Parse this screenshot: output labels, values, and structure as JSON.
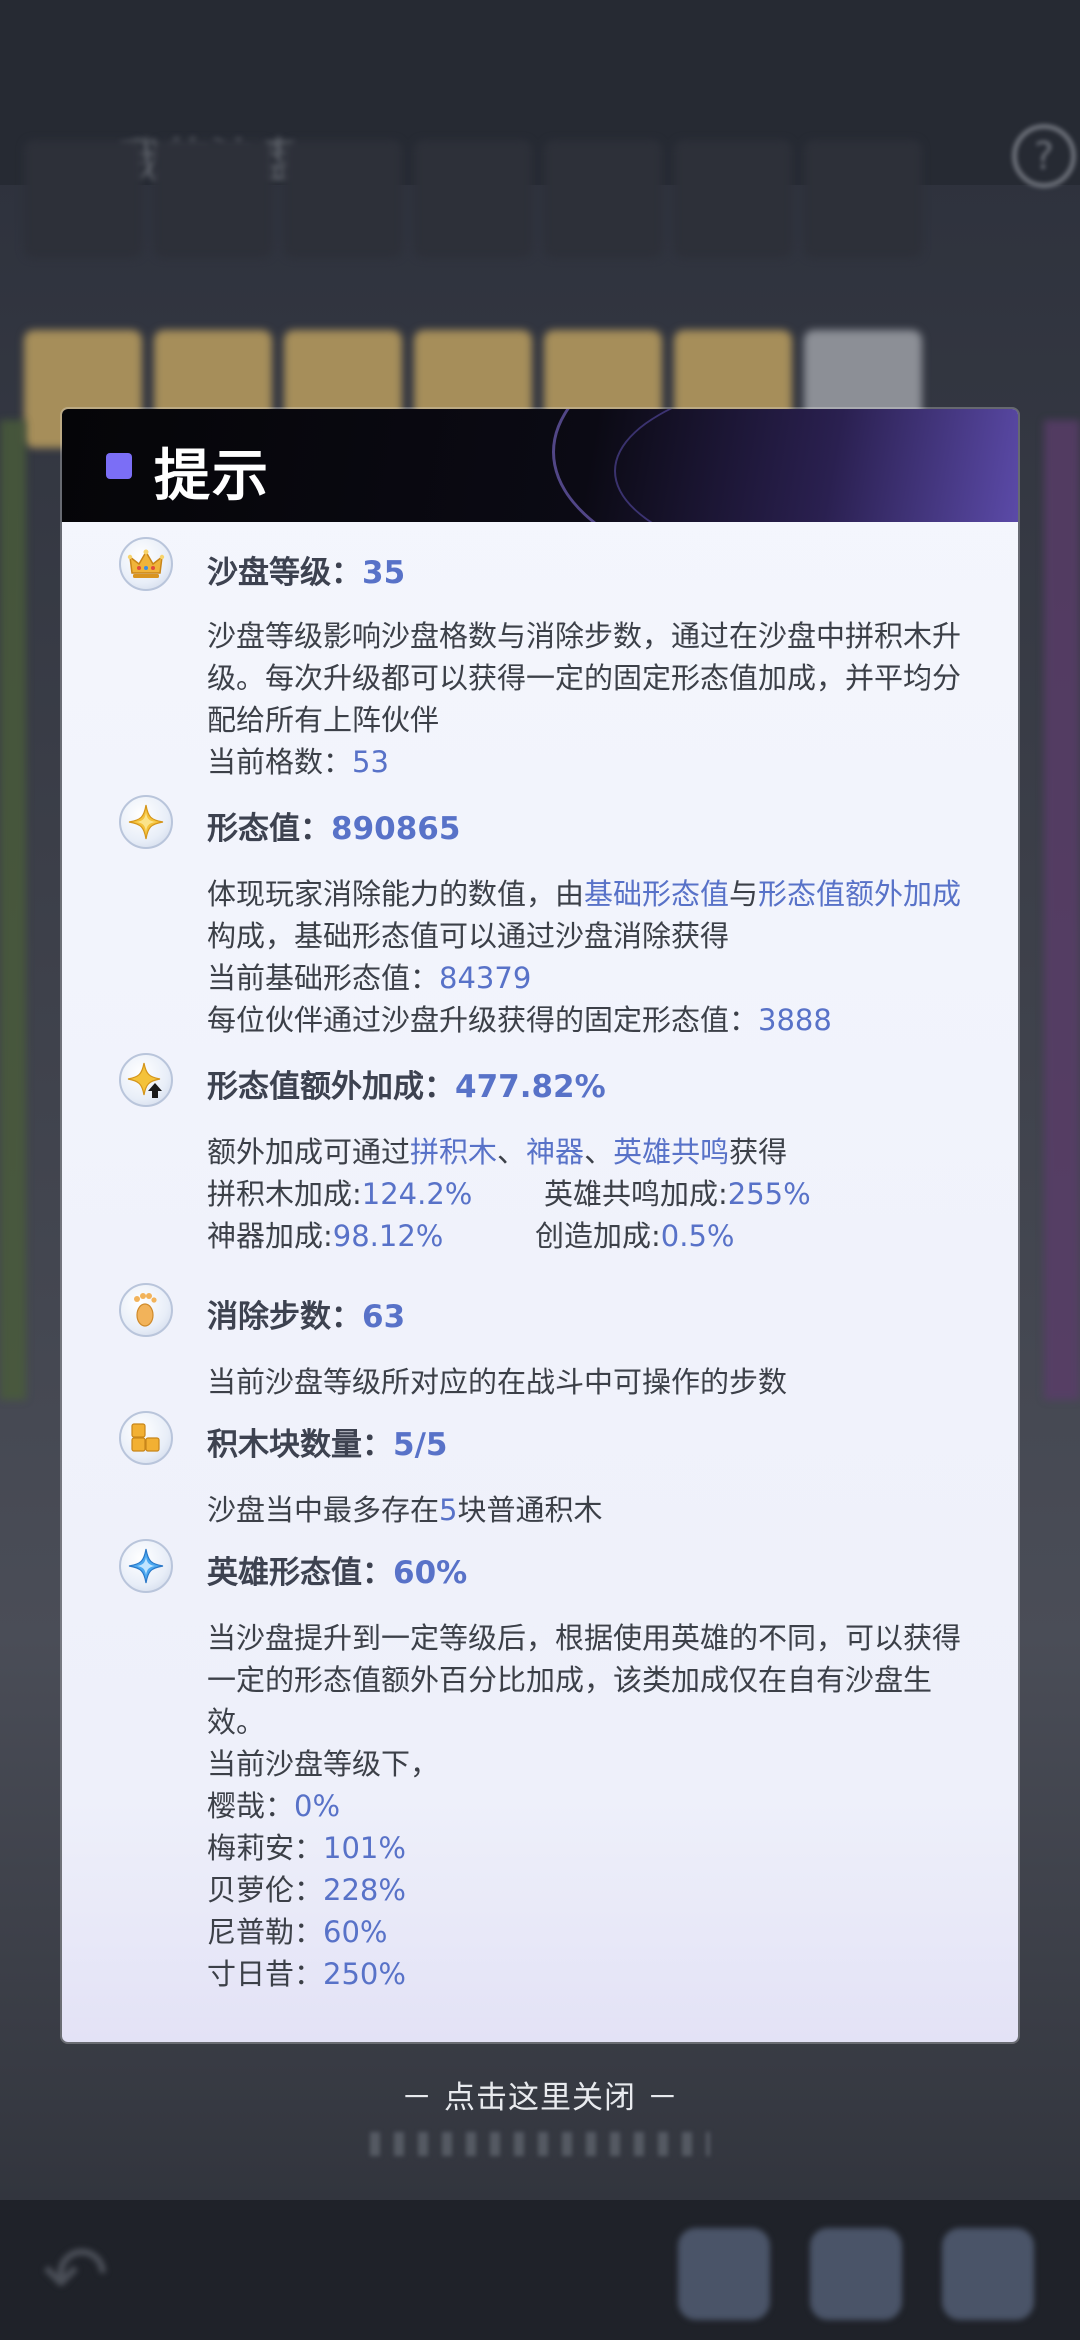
{
  "background": {
    "title": "我的沙盘",
    "help_icon": "?",
    "back_icon": "↶"
  },
  "dialog": {
    "title": "提示",
    "sections": {
      "sandbox_level": {
        "label": "沙盘等级：",
        "value": "35",
        "desc": "沙盘等级影响沙盘格数与消除步数，通过在沙盘中拼积木升级。每次升级都可以获得一定的固定形态值加成，并平均分配给所有上阵伙伴",
        "cells_label": "当前格数：",
        "cells_value": "53"
      },
      "form_value": {
        "label": "形态值：",
        "value": "890865",
        "desc_part1": "体现玩家消除能力的数值，由",
        "link1": "基础形态值",
        "desc_part2": "与",
        "link2": "形态值额外加成",
        "desc_part3": "构成，基础形态值可以通过沙盘消除获得",
        "base_label": "当前基础形态值：",
        "base_value": "84379",
        "partner_label": "每位伙伴通过沙盘升级获得的固定形态值：",
        "partner_value": "3888"
      },
      "extra_bonus": {
        "label": "形态值额外加成：",
        "value": "477.82%",
        "desc_part1": "额外加成可通过",
        "link1": "拼积木",
        "sep1": "、",
        "link2": "神器",
        "sep2": "、",
        "link3": "英雄共鸣",
        "desc_part2": "获得",
        "puzzle_label": "拼积木加成:",
        "puzzle_value": "124.2%",
        "resonance_label": "英雄共鸣加成:",
        "resonance_value": "255%",
        "artifact_label": "神器加成:",
        "artifact_value": "98.12%",
        "create_label": "创造加成:",
        "create_value": "0.5%"
      },
      "elim_steps": {
        "label": "消除步数：",
        "value": "63",
        "desc": "当前沙盘等级所对应的在战斗中可操作的步数"
      },
      "block_count": {
        "label": "积木块数量：",
        "value": "5/5",
        "desc_part1": "沙盘当中最多存在",
        "desc_num": "5",
        "desc_part2": "块普通积木"
      },
      "hero_form": {
        "label": "英雄形态值：",
        "value": "60%",
        "desc": "当沙盘提升到一定等级后，根据使用英雄的不同，可以获得一定的形态值额外百分比加成，该类加成仅在自有沙盘生效。",
        "current_label": "当前沙盘等级下，",
        "heroes": [
          {
            "name": "樱哉：",
            "value": "0%"
          },
          {
            "name": "梅莉安：",
            "value": "101%"
          },
          {
            "name": "贝萝伦：",
            "value": "228%"
          },
          {
            "name": "尼普勒：",
            "value": "60%"
          },
          {
            "name": "寸日昔：",
            "value": "250%"
          }
        ]
      }
    }
  },
  "close_hint": "－ 点击这里关闭 －",
  "colors": {
    "accent": "#5872c8",
    "text": "#3c4048",
    "title_square": "#7b6ef6"
  }
}
